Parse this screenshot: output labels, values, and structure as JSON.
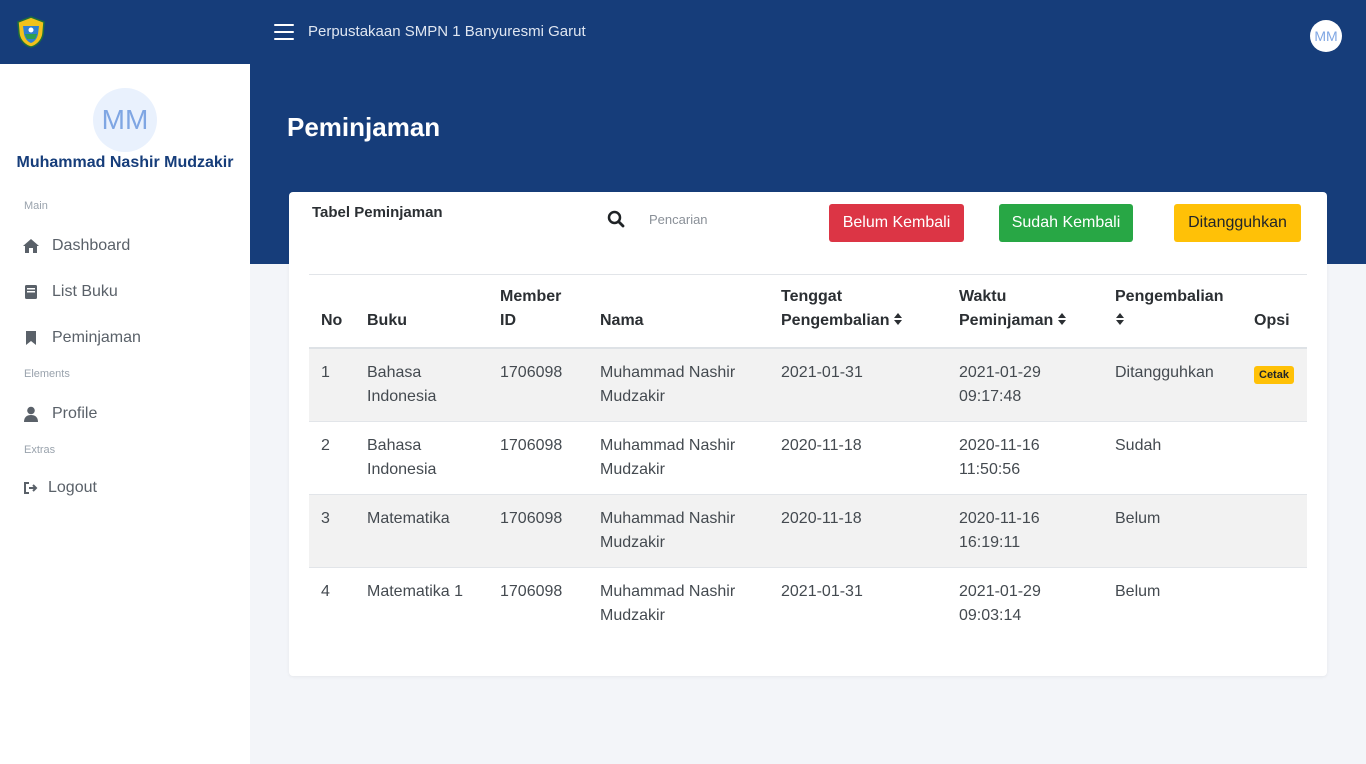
{
  "header": {
    "app_title": "Perpustakaan SMPN 1 Banyuresmi Garut",
    "avatar_initials": "MM"
  },
  "sidebar": {
    "avatar_initials": "MM",
    "user_name": "Muhammad Nashir Mudzakir",
    "sections": {
      "main": "Main",
      "elements": "Elements",
      "extras": "Extras"
    },
    "items": [
      {
        "label": "Dashboard",
        "icon": "home-icon"
      },
      {
        "label": "List Buku",
        "icon": "book-icon"
      },
      {
        "label": "Peminjaman",
        "icon": "bookmark-icon"
      },
      {
        "label": "Profile",
        "icon": "user-icon"
      },
      {
        "label": "Logout",
        "icon": "logout-icon"
      }
    ]
  },
  "page": {
    "title": "Peminjaman"
  },
  "card": {
    "title": "Tabel Peminjaman",
    "search_placeholder": "Pencarian",
    "buttons": {
      "belum": "Belum Kembali",
      "sudah": "Sudah Kembali",
      "ditangguhkan": "Ditangguhkan"
    }
  },
  "table": {
    "columns": {
      "no": "No",
      "buku": "Buku",
      "member_id": "Member ID",
      "nama": "Nama",
      "tenggat": "Tenggat Pengembalian",
      "waktu": "Waktu Peminjaman",
      "pengembalian": "Pengembalian",
      "opsi": "Opsi"
    },
    "rows": [
      {
        "no": "1",
        "buku": "Bahasa Indonesia",
        "member_id": "1706098",
        "nama": "Muhammad Nashir Mudzakir",
        "tenggat": "2021-01-31",
        "waktu": "2021-01-29 09:17:48",
        "pengembalian": "Ditangguhkan",
        "opsi": "Cetak"
      },
      {
        "no": "2",
        "buku": "Bahasa Indonesia",
        "member_id": "1706098",
        "nama": "Muhammad Nashir Mudzakir",
        "tenggat": "2020-11-18",
        "waktu": "2020-11-16 11:50:56",
        "pengembalian": "Sudah",
        "opsi": ""
      },
      {
        "no": "3",
        "buku": "Matematika",
        "member_id": "1706098",
        "nama": "Muhammad Nashir Mudzakir",
        "tenggat": "2020-11-18",
        "waktu": "2020-11-16 16:19:11",
        "pengembalian": "Belum",
        "opsi": ""
      },
      {
        "no": "4",
        "buku": "Matematika 1",
        "member_id": "1706098",
        "nama": "Muhammad Nashir Mudzakir",
        "tenggat": "2021-01-31",
        "waktu": "2021-01-29 09:03:14",
        "pengembalian": "Belum",
        "opsi": ""
      }
    ]
  },
  "colors": {
    "primary": "#163d7a",
    "danger": "#dc3545",
    "success": "#28a745",
    "warning": "#ffc107"
  }
}
